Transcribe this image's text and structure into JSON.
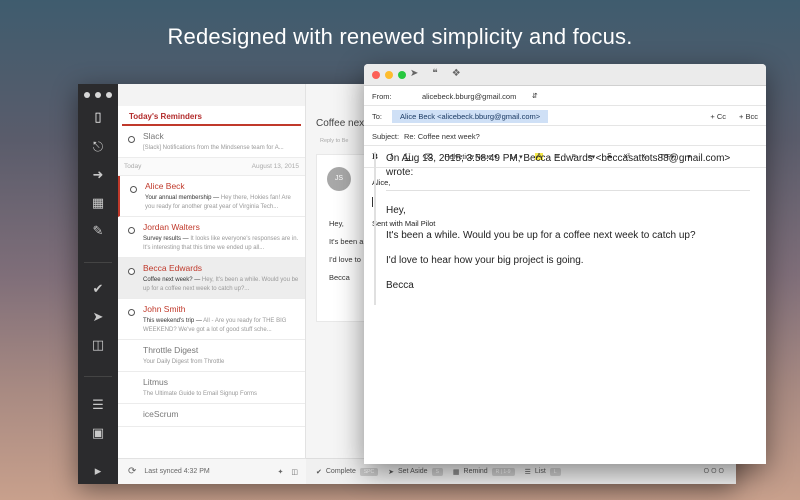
{
  "headline": "Redesigned with renewed simplicity and focus.",
  "sidebar": {
    "icons": [
      "mailpilot-logo-icon",
      "bell-icon",
      "inbox-arrow-icon",
      "calendar-icon",
      "pencil-icon",
      "check-icon",
      "send-icon",
      "trash-icon",
      "list-icon",
      "folder-icon",
      "collapse-icon"
    ]
  },
  "list": {
    "reminders_title": "Today's Reminders",
    "today_label": "Today",
    "today_date": "August 13, 2015",
    "items": [
      {
        "sender": "Slack",
        "subject": "",
        "preview": "[Slack] Notifications from the Mindsense team for A..."
      },
      {
        "sender": "Alice Beck",
        "subject": "Your annual membership —",
        "preview": " Hey there, Hokies fan! Are you ready for another great year of Virginia Tech..."
      },
      {
        "sender": "Jordan Walters",
        "subject": "Survey results —",
        "preview": " It looks like everyone's responses are in. It's interesting that this time we ended up all..."
      },
      {
        "sender": "Becca Edwards",
        "subject": "Coffee next week? —",
        "preview": " Hey, It's been a while. Would you be up for a coffee next week to catch up?..."
      },
      {
        "sender": "John Smith",
        "subject": "This weekend's trip —",
        "preview": " All - Are you ready for THE BIG WEEKEND? We've got a lot of good stuff sche..."
      },
      {
        "sender": "Throttle Digest",
        "subject": "",
        "preview": "Your Daily Digest from Throttle"
      },
      {
        "sender": "Litmus",
        "subject": "",
        "preview": "The Ultimate Guide to Email Signup Forms"
      },
      {
        "sender": "iceScrum",
        "subject": "",
        "preview": ""
      }
    ],
    "sync_status": "Last synced 4:32 PM"
  },
  "reading": {
    "subject": "Coffee next",
    "reply_to": "Reply to Be",
    "avatar_initials": "JS",
    "lines": [
      "Hey,",
      "It's been a",
      "I'd love to",
      "Becca"
    ]
  },
  "footer": {
    "complete": "Complete",
    "complete_key": "SPC",
    "set_aside": "Set Aside",
    "set_aside_key": "S",
    "remind": "Remind",
    "remind_key": "R | 1-9",
    "list": "List",
    "list_key": "L",
    "more": "OOO"
  },
  "compose": {
    "from_label": "From:",
    "from_value": "alicebeck.bburg@gmail.com",
    "to_label": "To:",
    "to_value": "Alice Beck <alicebeck.bburg@gmail.com>",
    "cc": "+ Cc",
    "bcc": "+ Bcc",
    "subject_label": "Subject:",
    "subject_value": "Re: Coffee next week?",
    "font_name": "Helvetica Neue",
    "font_size": "14",
    "greeting": "Alice,",
    "signature": "Sent with Mail Pilot",
    "quote_attr": "On Aug 13, 2015, 3:58:49 PM, Becca Edwards <beccasattots88@gmail.com> wrote:",
    "quote_lines": [
      "Hey,",
      "It's been a while. Would you be up for a coffee next week to catch up?",
      "I'd love to hear how your big project is going.",
      "Becca"
    ]
  },
  "colors": {
    "accent": "#c0392b",
    "rail": "#2b2b2d",
    "chip": "#cfe0f6"
  }
}
